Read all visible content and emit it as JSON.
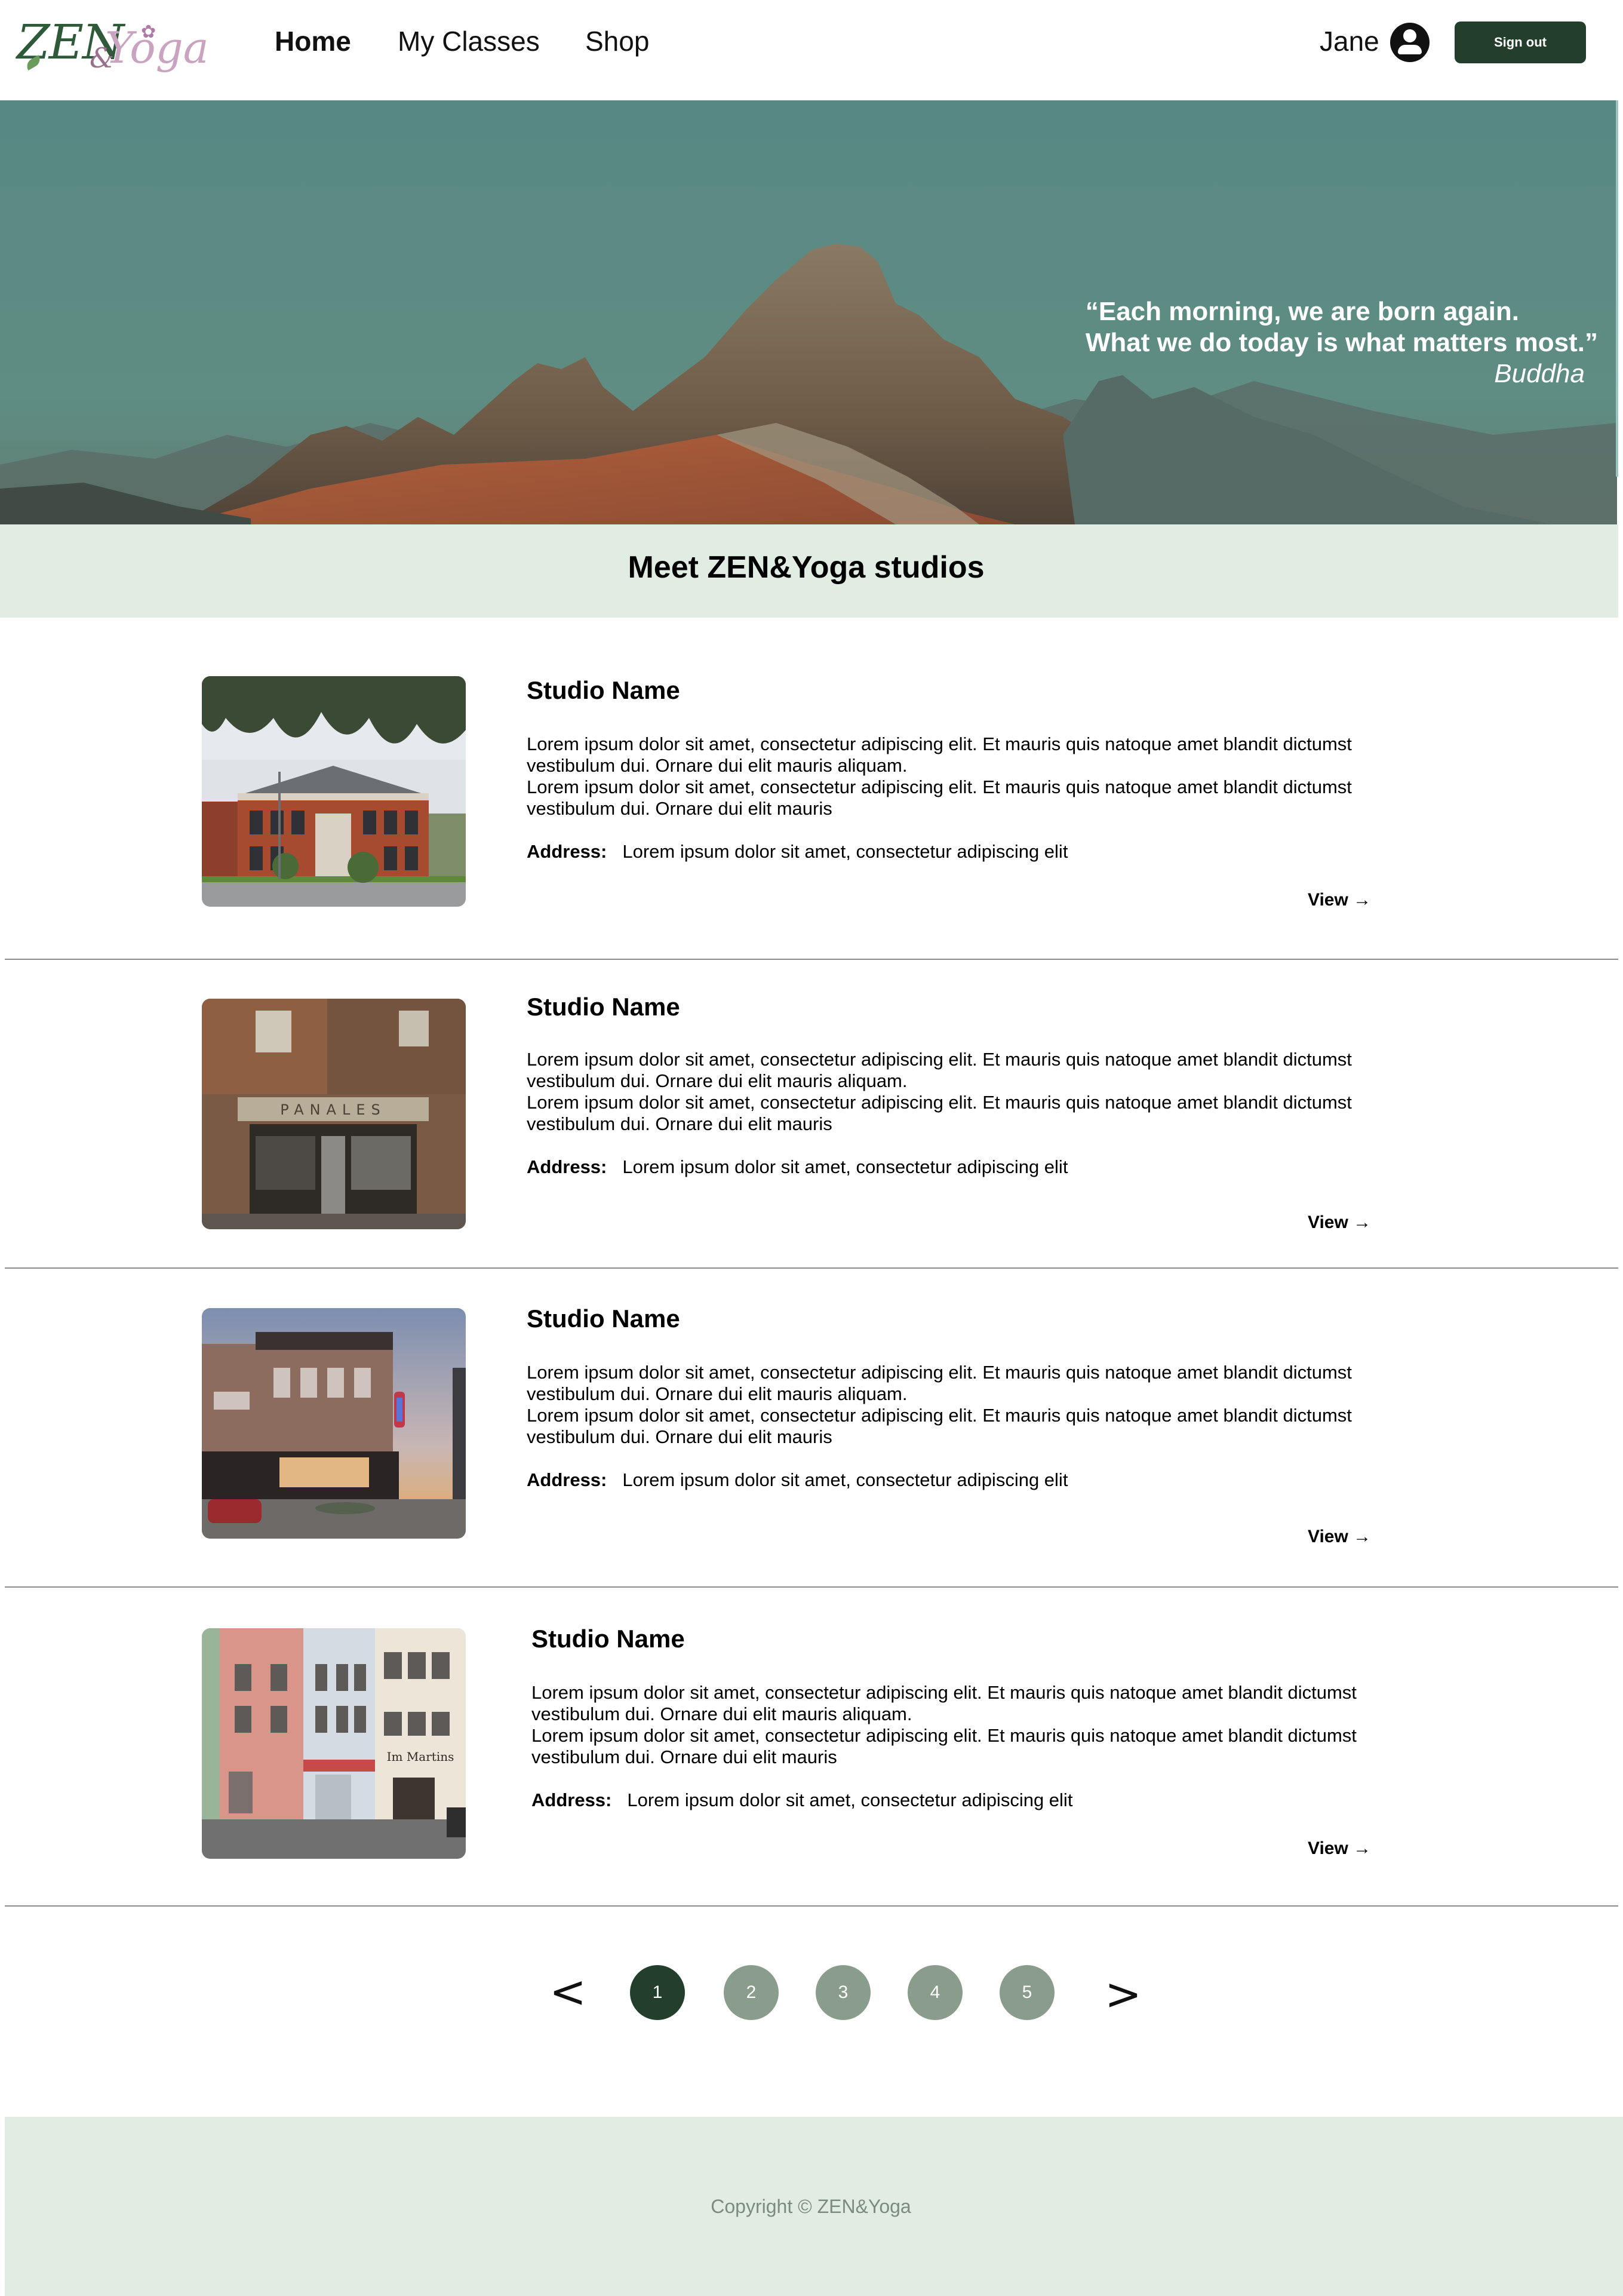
{
  "header": {
    "logo": {
      "zen": "ZEN",
      "amp": "&",
      "yoga": "Yoga"
    },
    "nav": {
      "home": "Home",
      "classes": "My Classes",
      "shop": "Shop"
    },
    "user_name": "Jane",
    "signout_label": "Sign out"
  },
  "hero": {
    "quote_line1": "“Each morning, we are born again.",
    "quote_line2": "What we do today is what matters most.”",
    "quote_author": "Buddha"
  },
  "section": {
    "title": "Meet ZEN&Yoga studios"
  },
  "studios": [
    {
      "name": "Studio Name",
      "desc1": "Lorem ipsum dolor sit amet, consectetur adipiscing elit. Et mauris quis natoque amet blandit dictumst vestibulum dui. Ornare dui elit mauris aliquam.",
      "desc2": "Lorem ipsum dolor sit amet, consectetur adipiscing elit. Et mauris quis natoque amet blandit dictumst vestibulum dui. Ornare dui elit mauris",
      "address_label": "Address:",
      "address": "Lorem ipsum dolor sit amet, consectetur adipiscing elit",
      "view_label": "View →"
    },
    {
      "name": "Studio Name",
      "desc1": "Lorem ipsum dolor sit amet, consectetur adipiscing elit. Et mauris quis natoque amet blandit dictumst vestibulum dui. Ornare dui elit mauris aliquam.",
      "desc2": "Lorem ipsum dolor sit amet, consectetur adipiscing elit. Et mauris quis natoque amet blandit dictumst vestibulum dui. Ornare dui elit mauris",
      "address_label": "Address:",
      "address": "Lorem ipsum dolor sit amet, consectetur adipiscing elit",
      "view_label": "View →",
      "sign_text": "PANALES"
    },
    {
      "name": "Studio Name",
      "desc1": "Lorem ipsum dolor sit amet, consectetur adipiscing elit. Et mauris quis natoque amet blandit dictumst vestibulum dui. Ornare dui elit mauris aliquam.",
      "desc2": "Lorem ipsum dolor sit amet, consectetur adipiscing elit. Et mauris quis natoque amet blandit dictumst vestibulum dui. Ornare dui elit mauris",
      "address_label": "Address:",
      "address": "Lorem ipsum dolor sit amet, consectetur adipiscing elit",
      "view_label": "View →"
    },
    {
      "name": "Studio Name",
      "desc1": "Lorem ipsum dolor sit amet, consectetur adipiscing elit. Et mauris quis natoque amet blandit dictumst vestibulum dui. Ornare dui elit mauris aliquam.",
      "desc2": "Lorem ipsum dolor sit amet, consectetur adipiscing elit. Et mauris quis natoque amet blandit dictumst vestibulum dui. Ornare dui elit mauris",
      "address_label": "Address:",
      "address": "Lorem ipsum dolor sit amet, consectetur adipiscing elit",
      "view_label": "View →",
      "sign_text": "Im Martins"
    }
  ],
  "pagination": {
    "prev": "<",
    "next": ">",
    "pages": [
      "1",
      "2",
      "3",
      "4",
      "5"
    ],
    "current": "1"
  },
  "footer": {
    "copyright": "Copyright © ZEN&Yoga"
  },
  "colors": {
    "brand_dark": "#233f2c",
    "band_bg": "#e1ede3",
    "page_inactive": "#8a9c8c"
  },
  "icons": {
    "user": "user-circle-icon",
    "arrow": "arrow-right-icon"
  }
}
